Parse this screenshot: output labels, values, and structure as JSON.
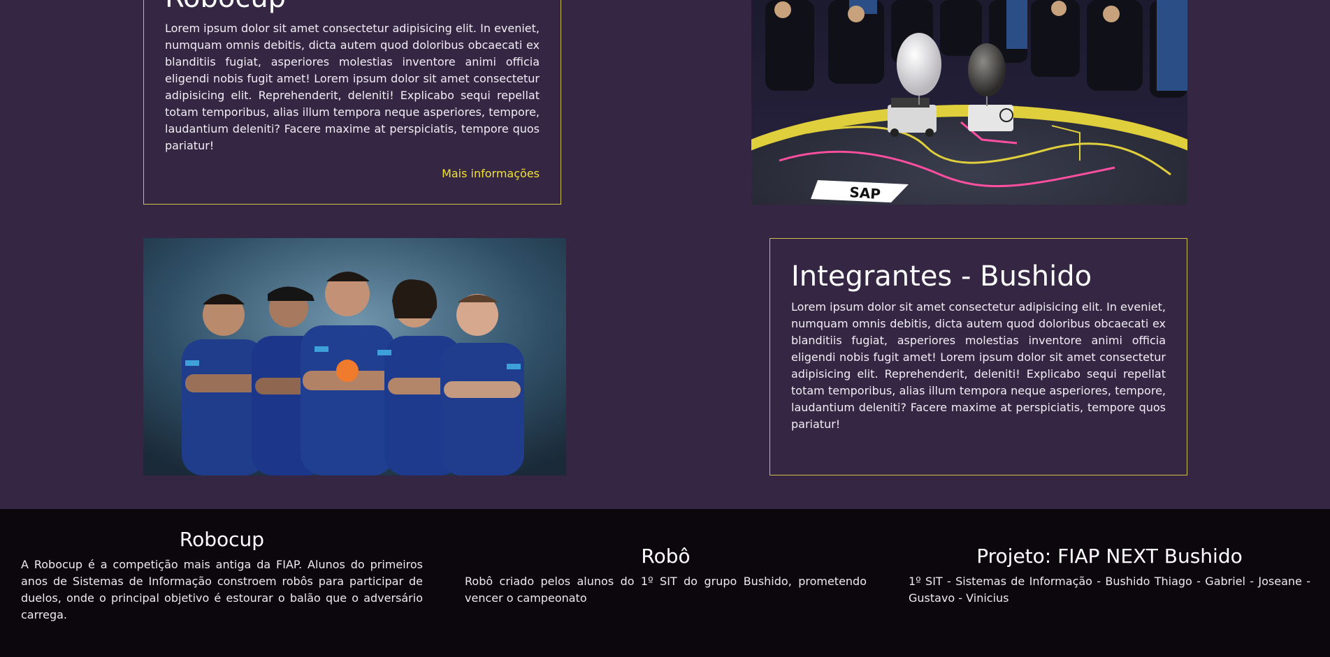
{
  "section_robocup": {
    "title": "Robocup",
    "text": "Lorem ipsum dolor sit amet consectetur adipisicing elit. In eveniet, numquam omnis debitis, dicta autem quod doloribus obcaecati ex blanditiis fugiat, asperiores molestias inventore animi officia eligendi nobis fugit amet! Lorem ipsum dolor sit amet consectetur adipisicing elit. Reprehenderit, deleniti! Explicabo sequi repellat totam temporibus, alias illum tempora neque asperiores, tempore, laudantium deleniti? Facere maxime at perspiciatis, tempore quos pariatur!",
    "link": "Mais informações"
  },
  "section_members": {
    "title": "Integrantes - Bushido",
    "text": "Lorem ipsum dolor sit amet consectetur adipisicing elit. In eveniet, numquam omnis debitis, dicta autem quod doloribus obcaecati ex blanditiis fugiat, asperiores molestias inventore animi officia eligendi nobis fugit amet! Lorem ipsum dolor sit amet consectetur adipisicing elit. Reprehenderit, deleniti! Explicabo sequi repellat totam temporibus, alias illum tempora neque asperiores, tempore, laudantium deleniti? Facere maxime at perspiciatis, tempore quos pariatur!"
  },
  "arena_photo": {
    "logo_text": "SAP"
  },
  "footer": {
    "col1": {
      "title": "Robocup",
      "text": "A Robocup é a competição mais antiga da FIAP. Alunos do primeiros anos de Sistemas de Informação constroem robôs para participar de duelos, onde o principal objetivo é estourar o balão que o adversário carrega."
    },
    "col2": {
      "title": "Robô",
      "text": "Robô criado pelos alunos do 1º SIT do grupo Bushido, prometendo vencer o campeonato"
    },
    "col3": {
      "title": "Projeto: FIAP NEXT Bushido",
      "text": "1º SIT - Sistemas de Informação - Bushido Thiago - Gabriel - Joseane - Gustavo - Vinicius"
    }
  },
  "colors": {
    "background": "#352643",
    "footer": "#0b070d",
    "accent": "#f2e22c",
    "border": "#cdbf4a"
  }
}
